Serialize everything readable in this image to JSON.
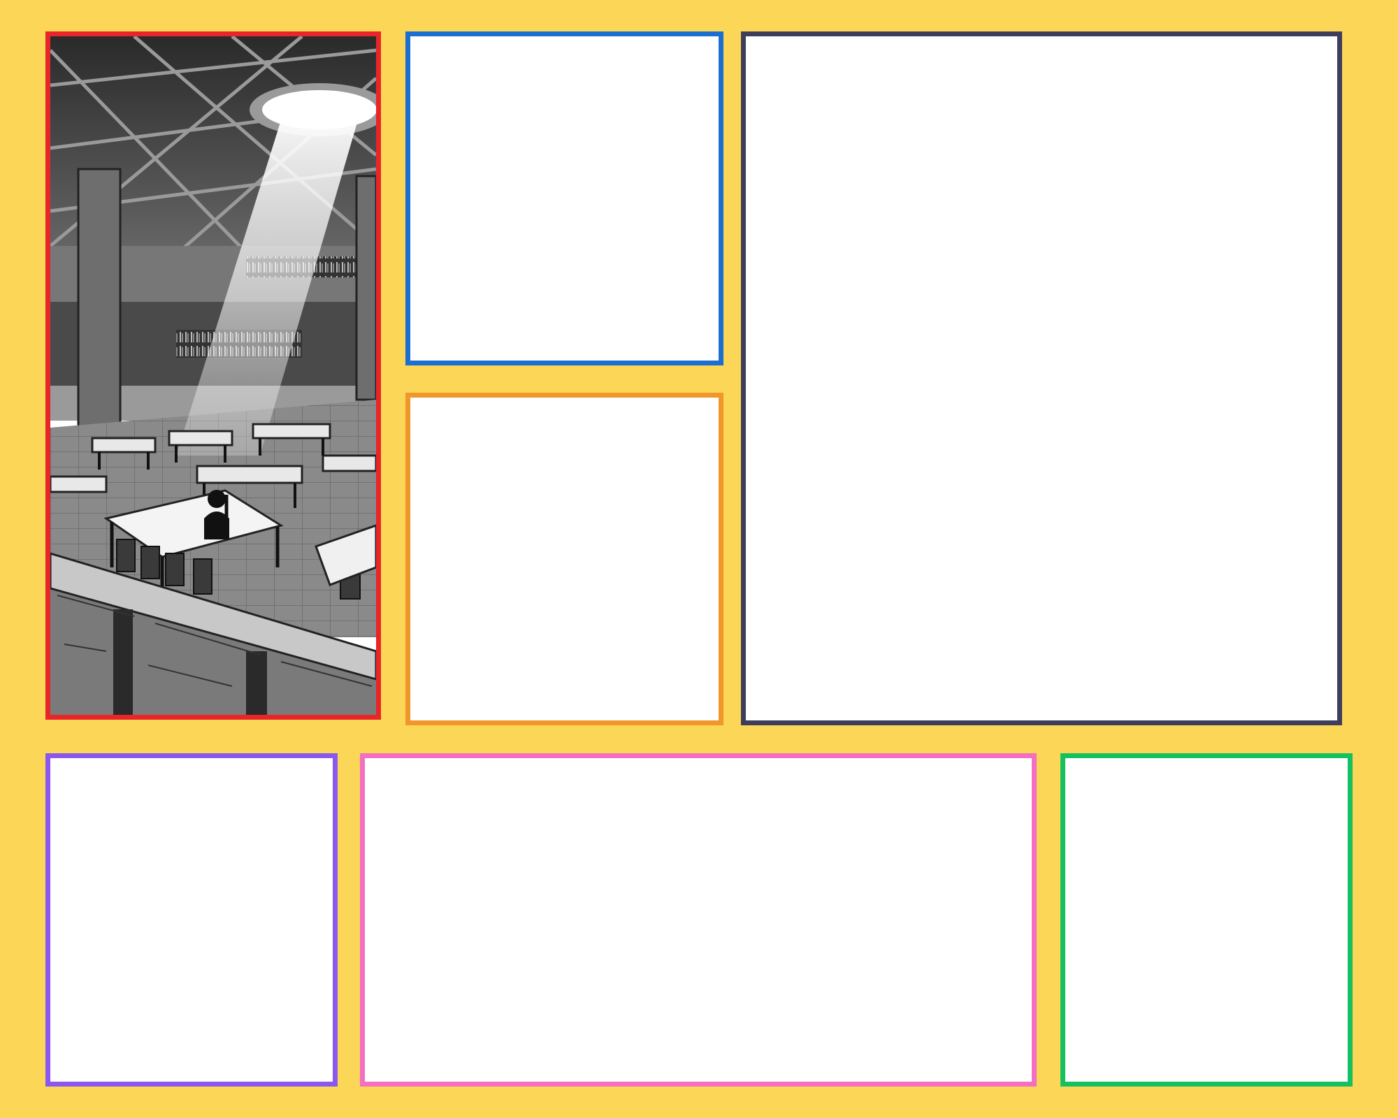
{
  "page": {
    "background": "#FCD757"
  },
  "panels": [
    {
      "id": "p-red",
      "border_color": "#E8262A",
      "content": "library-reading-hall-illustration"
    },
    {
      "id": "p-blue",
      "border_color": "#1A6FD0",
      "content": "empty"
    },
    {
      "id": "p-orange",
      "border_color": "#F0962A",
      "content": "empty"
    },
    {
      "id": "p-navy",
      "border_color": "#3F3D5C",
      "content": "empty"
    },
    {
      "id": "p-purple",
      "border_color": "#8A57F0",
      "content": "empty"
    },
    {
      "id": "p-pink",
      "border_color": "#F46EC2",
      "content": "empty"
    },
    {
      "id": "p-green",
      "border_color": "#15C060",
      "content": "empty"
    }
  ]
}
